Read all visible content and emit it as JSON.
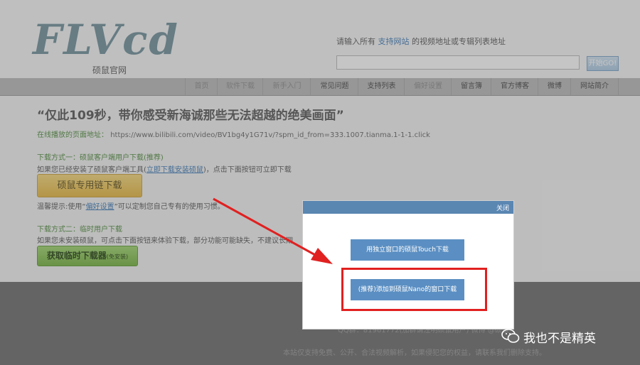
{
  "header": {
    "logo_text": "FLVcd",
    "logo_sub": "硕鼠官网",
    "search_tip_pre": "请输入所有",
    "search_tip_link": "支持网站",
    "search_tip_post": "的视频地址或专辑列表地址",
    "go_label": "开始GO!"
  },
  "nav": {
    "items": [
      {
        "label": "首页"
      },
      {
        "label": "软件下载"
      },
      {
        "label": "新手入门"
      },
      {
        "label": "常见问题"
      },
      {
        "label": "支持列表"
      },
      {
        "label": "偏好设置"
      },
      {
        "label": "留言簿"
      },
      {
        "label": "官方博客"
      },
      {
        "label": "微博"
      },
      {
        "label": "网站简介"
      }
    ]
  },
  "main": {
    "title": "“仅此109秒，带你感受新海诚那些无法超越的绝美画面”",
    "url_label": "在线播放的页面地址：",
    "url_value": "https://www.bilibili.com/video/BV1bg4y1G71v/?spm_id_from=333.1007.tianma.1-1-1.click",
    "method1_title": "下载方式一：硕鼠客户端用户下载(推荐)",
    "method1_desc_pre": "如果您已经安装了硕鼠客户端工具(",
    "method1_desc_link": "立即下载安装硕鼠",
    "method1_desc_post": ")，点击下面按钮可立即下载",
    "method1_button": "硕鼠专用链下载",
    "tip_pre": "温馨提示:使用“",
    "tip_link": "偏好设置",
    "tip_post": "”可以定制您自己专有的使用习惯。",
    "method2_title": "下载方式二：临时用户下载",
    "method2_desc": "如果您未安装硕鼠，可点击下面按钮来体验下载，部分功能可能缺失，不建议长期",
    "method2_button": "获取临时下载器",
    "method2_button_small": "(免安装)"
  },
  "footer": {
    "qq": "QQ群：81961772(加群请注明硕鼠用户) 微博 @硕鼠",
    "copy": "本站仅支持免费、公开、合法视频解析，如果侵犯您的权益，请联系我们删除支持。"
  },
  "dialog": {
    "close_label": "关闭",
    "button1": "用独立窗口的硕鼠Touch下载",
    "button2": "(推荐)添加到硕鼠Nano的窗口下载"
  },
  "watermark": {
    "text": "我也不是精英"
  }
}
